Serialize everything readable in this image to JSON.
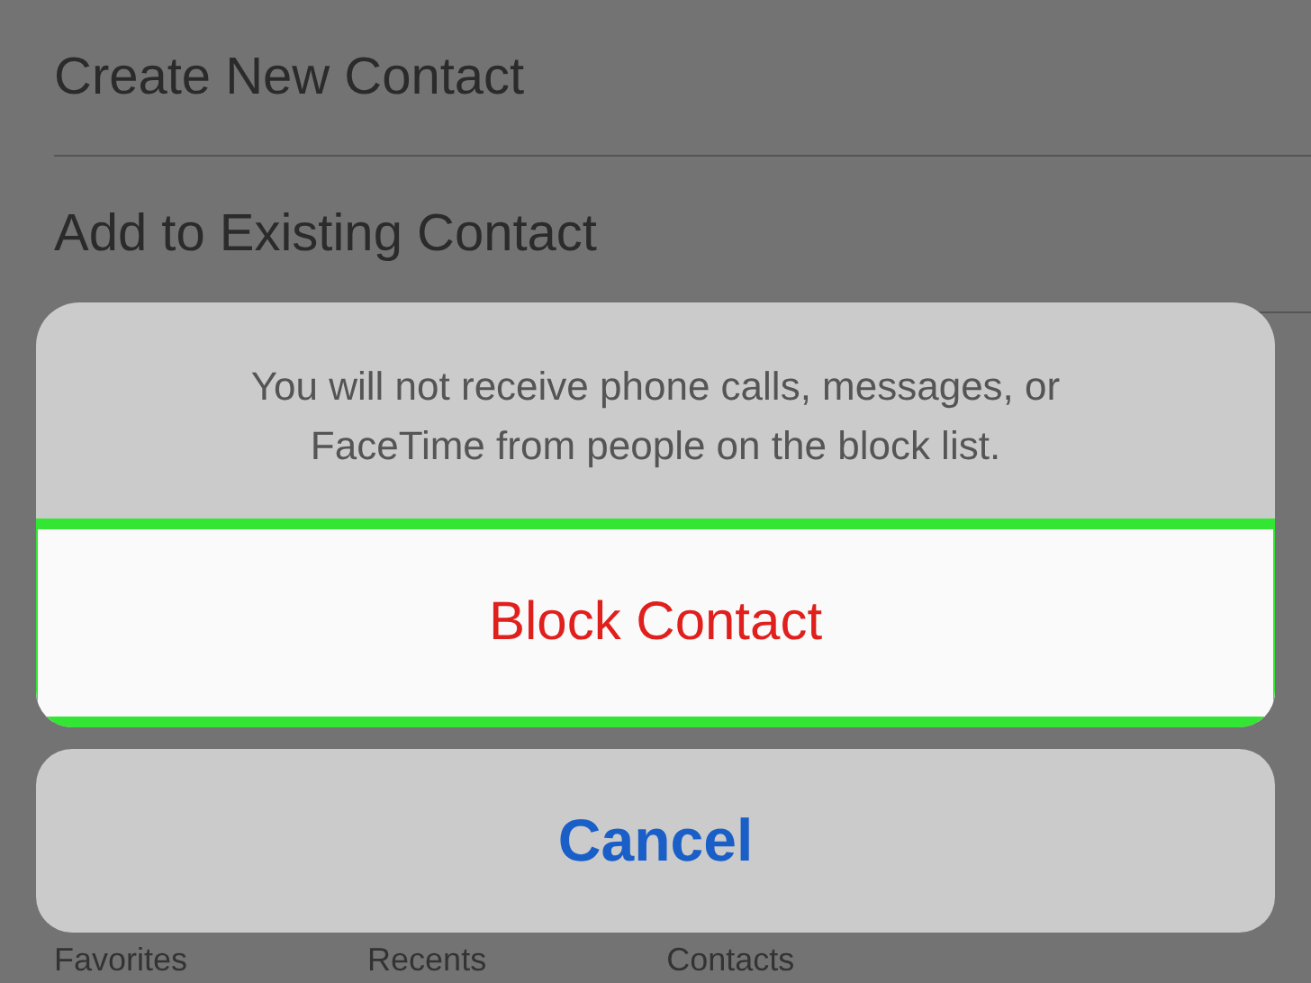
{
  "menu_items": [
    {
      "label": "Create New Contact"
    },
    {
      "label": "Add to Existing Contact"
    }
  ],
  "action_sheet": {
    "message": "You will not receive phone calls, messages, or FaceTime from people on the block list.",
    "action": {
      "label": "Block Contact",
      "highlighted": true
    },
    "cancel": {
      "label": "Cancel"
    }
  },
  "tab_bar": [
    {
      "label": "Favorites"
    },
    {
      "label": "Recents"
    },
    {
      "label": "Contacts"
    }
  ]
}
